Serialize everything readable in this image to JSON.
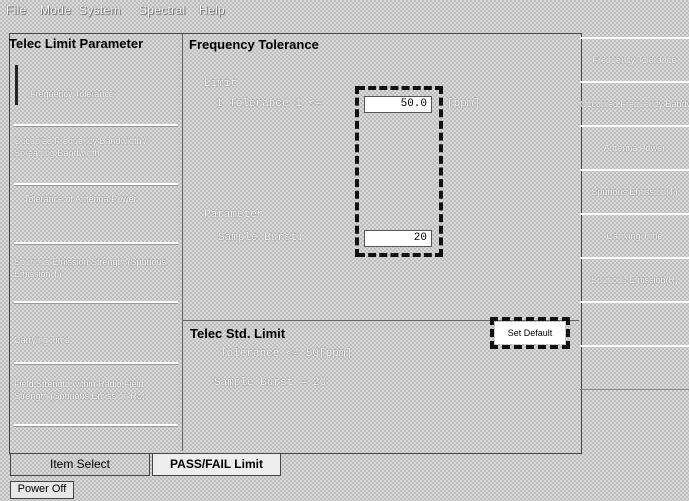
{
  "menu": [
    "File",
    "Mode",
    "System",
    "Spectral",
    "Help"
  ],
  "list_title": "Telec Limit Parameter",
  "params": [
    "Frequency Tolerance",
    "Occupied Frequency Bandwidth / Spreading Bandwidth",
    "Tolerance of Antenna Power",
    "Spurious Emission Strength (Spurious Emission T)",
    "Carrying Time",
    "Field Strength within Radio Field Strength (Spurious Emission Ro)"
  ],
  "freq": {
    "title": "Frequency Tolerance",
    "limit_label": "Limit",
    "tol_label": "1 Tolerance 1 <=",
    "tol_value": "50.0",
    "tol_unit": "[ppm]",
    "param_label": "Parameter",
    "sample_label": "Sample Burst:",
    "sample_value": "20"
  },
  "std": {
    "title": "Telec Std. Limit",
    "line1": "Tolerance <= 50[ppm]",
    "line2": "Sample Burst = 20",
    "default_btn": "Set Default"
  },
  "right_buttons": [
    "Frequency Tolerance",
    "Occupied Frequency Bandwidth / Spreading Bandwidth",
    "Antenna Power",
    "Spurious Emission(T)",
    "Carrying Time",
    "Spurious Emission(R)",
    "",
    ""
  ],
  "tabs": [
    "Item Select",
    "PASS/FAIL Limit"
  ],
  "power": "Power Off"
}
